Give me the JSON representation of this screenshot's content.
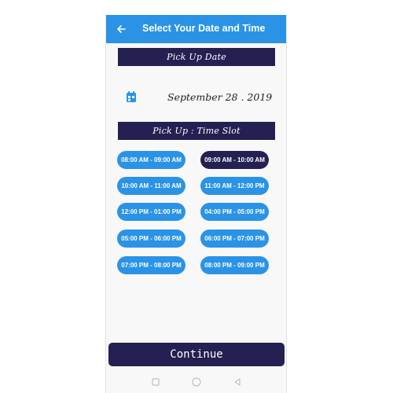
{
  "app_bar": {
    "title": "Select Your Date and Time",
    "back_icon": "arrow-left-icon"
  },
  "pickup_date": {
    "header": "Pick Up Date",
    "calendar_icon": "calendar-icon",
    "value": "September 28 . 2019"
  },
  "time_slot": {
    "header": "Pick Up :  Time Slot",
    "slots": [
      {
        "label": "08:00 AM  - 09:00 AM",
        "selected": false
      },
      {
        "label": "09:00 AM  - 10:00 AM",
        "selected": true
      },
      {
        "label": "10:00 AM  - 11:00 AM",
        "selected": false
      },
      {
        "label": "11:00 AM  - 12:00 PM",
        "selected": false
      },
      {
        "label": "12:00 PM  - 01:00 PM",
        "selected": false
      },
      {
        "label": "04:00 PM  - 05:00 PM",
        "selected": false
      },
      {
        "label": "05:00 PM  - 06:00 PM",
        "selected": false
      },
      {
        "label": "06:00 PM  - 07:00 PM",
        "selected": false
      },
      {
        "label": "07:00 PM  - 08:00 PM",
        "selected": false
      },
      {
        "label": "08:00 PM  - 09:00 PM",
        "selected": false
      }
    ]
  },
  "continue_label": "Continue",
  "colors": {
    "primary": "#2a93e6",
    "dark": "#242052",
    "background": "#f8f8f9"
  },
  "system_nav": {
    "icons": [
      "square-icon",
      "circle-icon",
      "triangle-back-icon"
    ]
  }
}
